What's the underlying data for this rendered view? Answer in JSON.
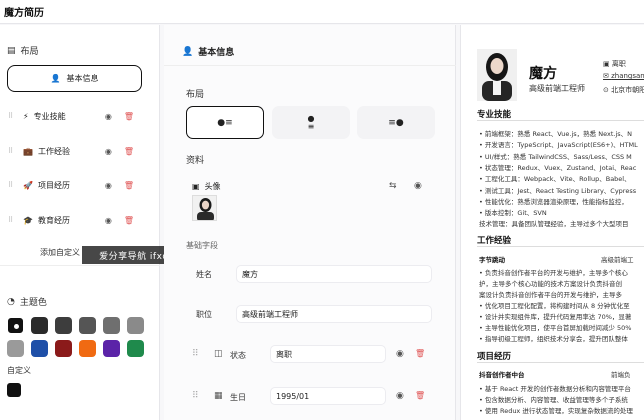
{
  "app": {
    "title": "魔方简历"
  },
  "left": {
    "layout_heading": "布局",
    "active_section": "基本信息",
    "sections": [
      {
        "label": "专业技能",
        "icon": "lightning-icon"
      },
      {
        "label": "工作经验",
        "icon": "briefcase-icon"
      },
      {
        "label": "项目经历",
        "icon": "rocket-icon"
      },
      {
        "label": "教育经历",
        "icon": "graduation-cap-icon"
      }
    ],
    "add_custom": "添加自定义",
    "theme_heading": "主题色",
    "colors": [
      "#111111",
      "#2b2b2b",
      "#3d3d3d",
      "#555555",
      "#6f6f6f",
      "#8a8a8a",
      "#9a9a9a",
      "#1e4fa8",
      "#8b1a1a",
      "#f06a12",
      "#5b23a8",
      "#1f8a4c"
    ],
    "custom_label": "自定义"
  },
  "watermark": "爱分享导航 ifxdh.com",
  "mid": {
    "header": "基本信息",
    "layout_label": "布局",
    "data_label": "资料",
    "avatar_label": "头像",
    "basic_fields_label": "基础字段",
    "fields": {
      "name_label": "姓名",
      "name_value": "魔方",
      "position_label": "职位",
      "position_value": "高级前端工程师",
      "status_label": "状态",
      "status_value": "离职",
      "birthday_label": "生日",
      "birthday_value": "1995/01"
    }
  },
  "resume": {
    "name": "魔方",
    "title": "高级前端工程师",
    "contacts": [
      "离职",
      "zhangsan",
      "北京市朝阳"
    ],
    "skills_heading": "专业技能",
    "skills": [
      "• 前端框架：熟悉 React、Vue.js，熟悉 Next.js、N",
      "• 开发语言：TypeScript、JavaScript(ES6+)、HTML",
      "• UI/样式：熟悉 TailwindCSS、Sass/Less、CSS M",
      "• 状态管理：Redux、Vuex、Zustand、Jotai、Reac",
      "• 工程化工具：Webpack、Vite、Rollup、Babel、",
      "• 测试工具：Jest、React Testing Library、Cypress",
      "• 性能优化：熟悉浏览器渲染原理，性能指标监控，",
      "• 版本控制：Git、SVN",
      "技术管理：具备团队管理经验，主导过多个大型项目"
    ],
    "work_heading": "工作经验",
    "work_company": "字节跳动",
    "work_role": "高级前端工",
    "work_lines": [
      "• 负责抖音创作者平台的开发与维护，主导多个核心",
      "  护，主导多个核心功能的技术方案设计负责抖音创",
      "  案设计负责抖音创作者平台的开发与维护，主导多",
      "• 优化项目工程化配置，将构建时间从 8 分钟优化至",
      "• 设计并实现组件库，提升代码复用率达 70%，显著",
      "• 主导性能优化项目，使平台首屏加载时间减少 50%",
      "• 指导初级工程师，组织技术分享会，提升团队整体"
    ],
    "project_heading": "项目经历",
    "project_name": "抖音创作者中台",
    "project_role": "前端负",
    "project_lines": [
      "• 基于 React 开发的创作者数据分析和内容管理平台",
      "• 包含数据分析、内容管理、收益管理等多个子系统",
      "• 使用 Redux 进行状态管理，实现复杂数据流的处理"
    ]
  }
}
